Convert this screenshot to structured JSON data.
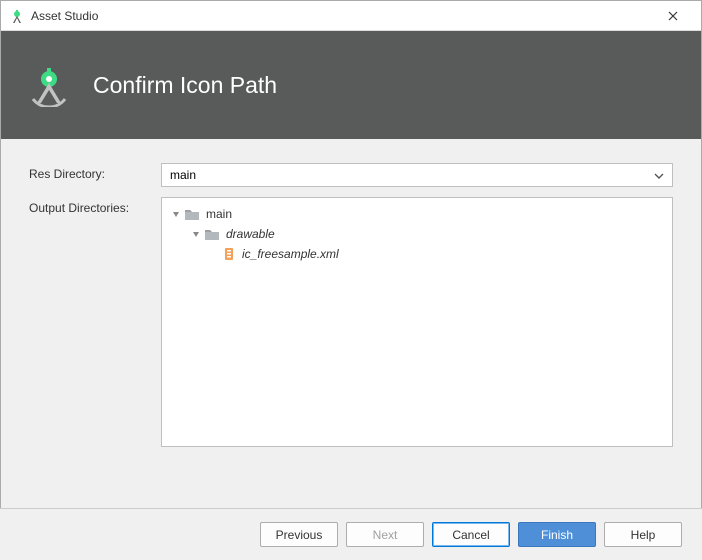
{
  "window": {
    "title": "Asset Studio"
  },
  "banner": {
    "title": "Confirm Icon Path"
  },
  "fields": {
    "res_dir_label": "Res Directory:",
    "res_dir_value": "main",
    "output_dir_label": "Output Directories:"
  },
  "tree": {
    "root": "main",
    "folder": "drawable",
    "file": "ic_freesample.xml"
  },
  "buttons": {
    "previous": "Previous",
    "next": "Next",
    "cancel": "Cancel",
    "finish": "Finish",
    "help": "Help"
  }
}
